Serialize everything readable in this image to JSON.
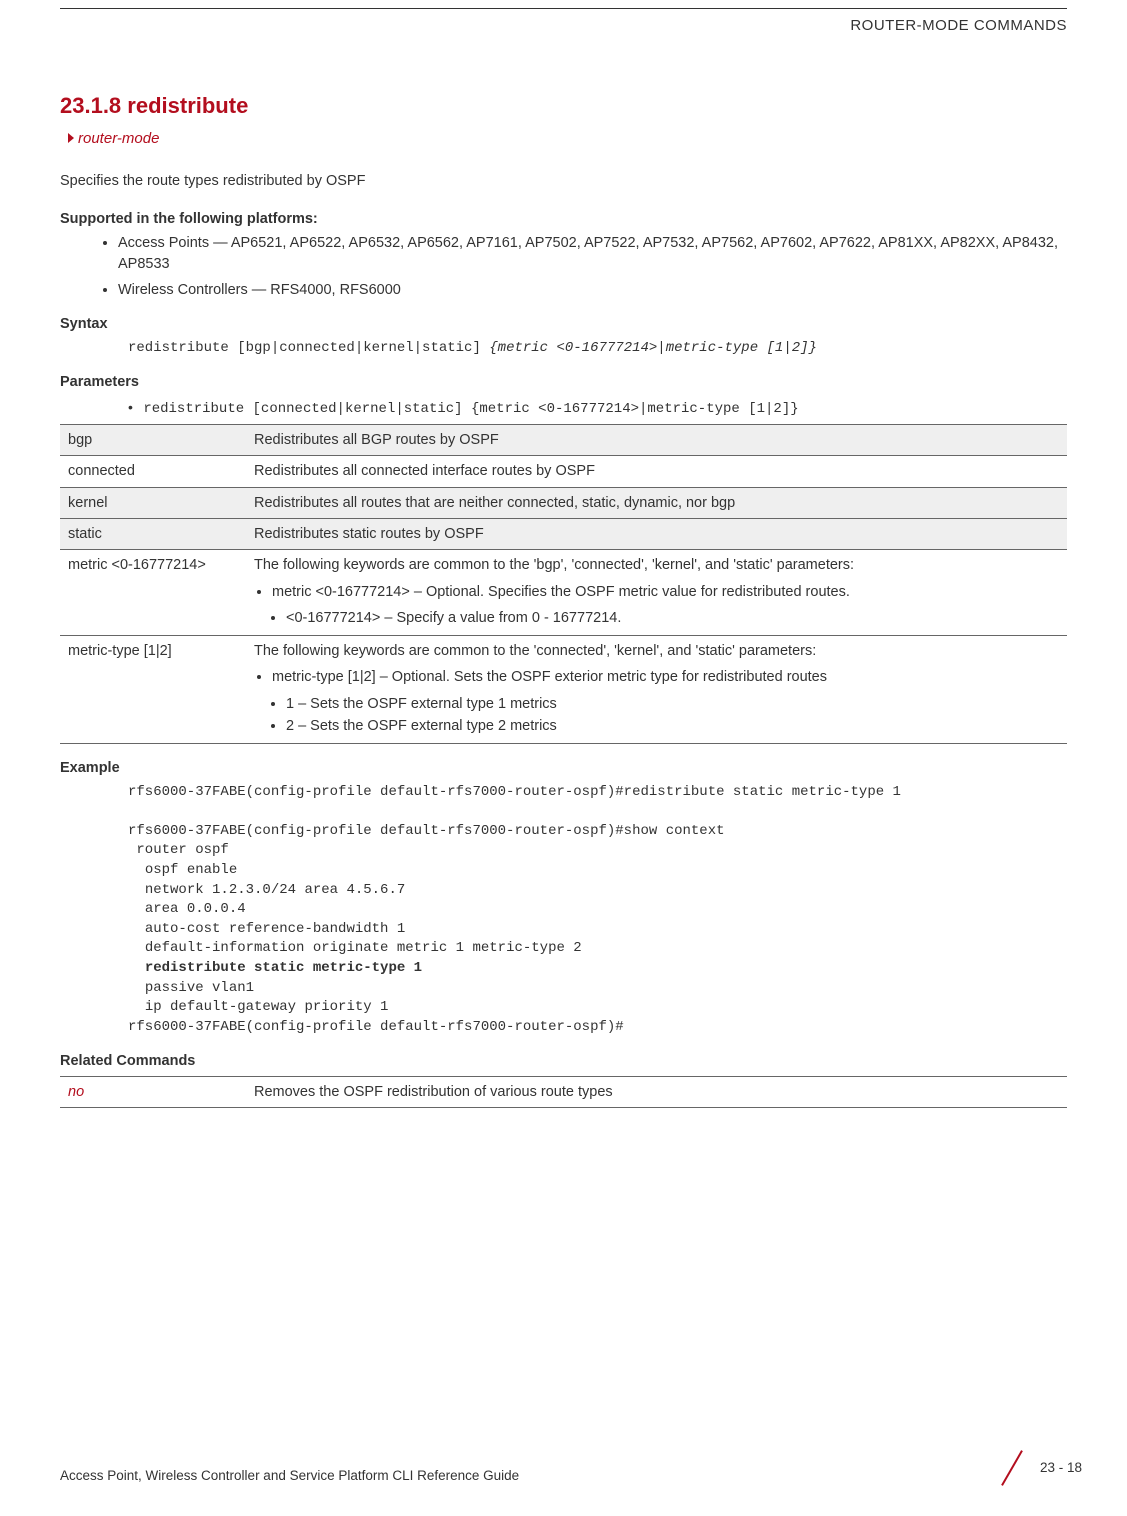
{
  "header": {
    "running_head": "ROUTER-MODE COMMANDS"
  },
  "section": {
    "number_title": "23.1.8 redistribute",
    "breadcrumb": "router-mode",
    "intro": "Specifies the route types redistributed by OSPF"
  },
  "platforms": {
    "heading": "Supported in the following platforms:",
    "items": [
      "Access Points — AP6521, AP6522, AP6532, AP6562, AP7161, AP7502, AP7522, AP7532, AP7562, AP7602, AP7622, AP81XX, AP82XX, AP8432, AP8533",
      "Wireless Controllers — RFS4000, RFS6000"
    ]
  },
  "syntax": {
    "heading": "Syntax",
    "line_plain": "redistribute [bgp|connected|kernel|static] ",
    "line_italic": "{metric <0-16777214>|metric-type [1|2]}"
  },
  "parameters": {
    "heading": "Parameters",
    "bullet_plain": "redistribute [connected|kernel|static] ",
    "bullet_italic": "{metric <0-16777214>|metric-type [1|2]}",
    "rows": [
      {
        "key": "bgp",
        "desc": "Redistributes all BGP routes by OSPF"
      },
      {
        "key": "connected",
        "desc": "Redistributes all connected interface routes by OSPF"
      },
      {
        "key": "kernel",
        "desc": "Redistributes all routes that are neither connected, static, dynamic, nor bgp"
      },
      {
        "key": "static",
        "desc": "Redistributes static routes by OSPF"
      }
    ],
    "metric": {
      "key": "metric <0-16777214>",
      "intro": "The following keywords are common to the 'bgp', 'connected', 'kernel', and 'static' parameters:",
      "b1": "metric <0-16777214> – Optional. Specifies the OSPF metric value for redistributed routes.",
      "b1a": "<0-16777214> – Specify a value from 0 - 16777214."
    },
    "metric_type": {
      "key": "metric-type [1|2]",
      "intro": "The following keywords are common to the 'connected', 'kernel', and 'static' parameters:",
      "b1": "metric-type [1|2] – Optional. Sets the OSPF exterior metric type for redistributed routes",
      "b1a": "1 – Sets the OSPF external type 1 metrics",
      "b1b": "2 – Sets the OSPF external type 2 metrics"
    }
  },
  "example": {
    "heading": "Example",
    "l1": "rfs6000-37FABE(config-profile default-rfs7000-router-ospf)#redistribute static metric-type 1",
    "l2": "rfs6000-37FABE(config-profile default-rfs7000-router-ospf)#show context",
    "l3": " router ospf",
    "l4": "  ospf enable",
    "l5": "  network 1.2.3.0/24 area 4.5.6.7",
    "l6": "  area 0.0.0.4",
    "l7": "  auto-cost reference-bandwidth 1",
    "l8": "  default-information originate metric 1 metric-type 2",
    "l9": "  redistribute static metric-type 1",
    "l10": "  passive vlan1",
    "l11": "  ip default-gateway priority 1",
    "l12": "rfs6000-37FABE(config-profile default-rfs7000-router-ospf)#"
  },
  "related": {
    "heading": "Related Commands",
    "key": "no",
    "desc": "Removes the OSPF redistribution of various route types"
  },
  "footer": {
    "doc_title": "Access Point, Wireless Controller and Service Platform CLI Reference Guide",
    "page": "23 - 18"
  }
}
